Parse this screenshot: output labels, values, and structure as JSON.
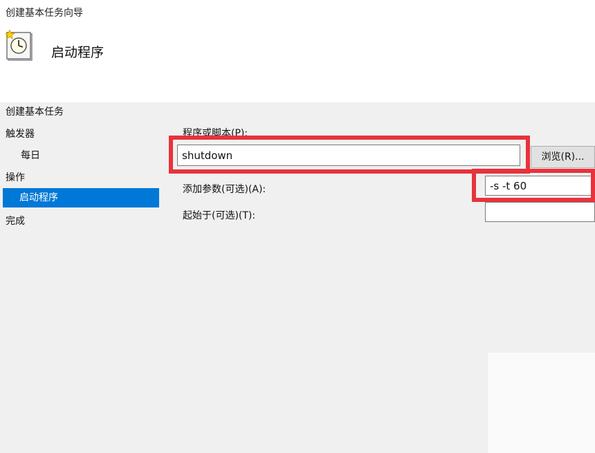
{
  "window": {
    "title": "创建基本任务向导"
  },
  "header": {
    "title": "启动程序",
    "icon": "task-clock-icon"
  },
  "steps": [
    {
      "label": "创建基本任务"
    },
    {
      "label": "触发器"
    },
    {
      "label": "每日"
    },
    {
      "label": "操作"
    },
    {
      "label": "启动程序"
    },
    {
      "label": "完成"
    }
  ],
  "form": {
    "program_label": "程序或脚本(P):",
    "program_value": "shutdown",
    "browse_label": "浏览(R)...",
    "args_label": "添加参数(可选)(A):",
    "args_value": "-s -t 60",
    "start_label": "起始于(可选)(T):",
    "start_value": ""
  },
  "colors": {
    "accent": "#0078d7",
    "highlight": "#e8323c",
    "background": "#f0f0f0"
  }
}
